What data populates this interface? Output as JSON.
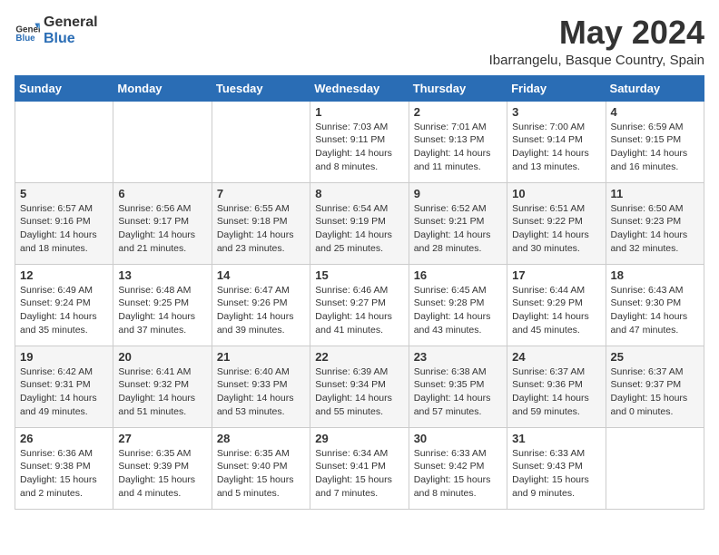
{
  "header": {
    "logo_general": "General",
    "logo_blue": "Blue",
    "month_title": "May 2024",
    "location": "Ibarrangelu, Basque Country, Spain"
  },
  "days_of_week": [
    "Sunday",
    "Monday",
    "Tuesday",
    "Wednesday",
    "Thursday",
    "Friday",
    "Saturday"
  ],
  "weeks": [
    [
      {
        "day": "",
        "content": ""
      },
      {
        "day": "",
        "content": ""
      },
      {
        "day": "",
        "content": ""
      },
      {
        "day": "1",
        "content": "Sunrise: 7:03 AM\nSunset: 9:11 PM\nDaylight: 14 hours\nand 8 minutes."
      },
      {
        "day": "2",
        "content": "Sunrise: 7:01 AM\nSunset: 9:13 PM\nDaylight: 14 hours\nand 11 minutes."
      },
      {
        "day": "3",
        "content": "Sunrise: 7:00 AM\nSunset: 9:14 PM\nDaylight: 14 hours\nand 13 minutes."
      },
      {
        "day": "4",
        "content": "Sunrise: 6:59 AM\nSunset: 9:15 PM\nDaylight: 14 hours\nand 16 minutes."
      }
    ],
    [
      {
        "day": "5",
        "content": "Sunrise: 6:57 AM\nSunset: 9:16 PM\nDaylight: 14 hours\nand 18 minutes."
      },
      {
        "day": "6",
        "content": "Sunrise: 6:56 AM\nSunset: 9:17 PM\nDaylight: 14 hours\nand 21 minutes."
      },
      {
        "day": "7",
        "content": "Sunrise: 6:55 AM\nSunset: 9:18 PM\nDaylight: 14 hours\nand 23 minutes."
      },
      {
        "day": "8",
        "content": "Sunrise: 6:54 AM\nSunset: 9:19 PM\nDaylight: 14 hours\nand 25 minutes."
      },
      {
        "day": "9",
        "content": "Sunrise: 6:52 AM\nSunset: 9:21 PM\nDaylight: 14 hours\nand 28 minutes."
      },
      {
        "day": "10",
        "content": "Sunrise: 6:51 AM\nSunset: 9:22 PM\nDaylight: 14 hours\nand 30 minutes."
      },
      {
        "day": "11",
        "content": "Sunrise: 6:50 AM\nSunset: 9:23 PM\nDaylight: 14 hours\nand 32 minutes."
      }
    ],
    [
      {
        "day": "12",
        "content": "Sunrise: 6:49 AM\nSunset: 9:24 PM\nDaylight: 14 hours\nand 35 minutes."
      },
      {
        "day": "13",
        "content": "Sunrise: 6:48 AM\nSunset: 9:25 PM\nDaylight: 14 hours\nand 37 minutes."
      },
      {
        "day": "14",
        "content": "Sunrise: 6:47 AM\nSunset: 9:26 PM\nDaylight: 14 hours\nand 39 minutes."
      },
      {
        "day": "15",
        "content": "Sunrise: 6:46 AM\nSunset: 9:27 PM\nDaylight: 14 hours\nand 41 minutes."
      },
      {
        "day": "16",
        "content": "Sunrise: 6:45 AM\nSunset: 9:28 PM\nDaylight: 14 hours\nand 43 minutes."
      },
      {
        "day": "17",
        "content": "Sunrise: 6:44 AM\nSunset: 9:29 PM\nDaylight: 14 hours\nand 45 minutes."
      },
      {
        "day": "18",
        "content": "Sunrise: 6:43 AM\nSunset: 9:30 PM\nDaylight: 14 hours\nand 47 minutes."
      }
    ],
    [
      {
        "day": "19",
        "content": "Sunrise: 6:42 AM\nSunset: 9:31 PM\nDaylight: 14 hours\nand 49 minutes."
      },
      {
        "day": "20",
        "content": "Sunrise: 6:41 AM\nSunset: 9:32 PM\nDaylight: 14 hours\nand 51 minutes."
      },
      {
        "day": "21",
        "content": "Sunrise: 6:40 AM\nSunset: 9:33 PM\nDaylight: 14 hours\nand 53 minutes."
      },
      {
        "day": "22",
        "content": "Sunrise: 6:39 AM\nSunset: 9:34 PM\nDaylight: 14 hours\nand 55 minutes."
      },
      {
        "day": "23",
        "content": "Sunrise: 6:38 AM\nSunset: 9:35 PM\nDaylight: 14 hours\nand 57 minutes."
      },
      {
        "day": "24",
        "content": "Sunrise: 6:37 AM\nSunset: 9:36 PM\nDaylight: 14 hours\nand 59 minutes."
      },
      {
        "day": "25",
        "content": "Sunrise: 6:37 AM\nSunset: 9:37 PM\nDaylight: 15 hours\nand 0 minutes."
      }
    ],
    [
      {
        "day": "26",
        "content": "Sunrise: 6:36 AM\nSunset: 9:38 PM\nDaylight: 15 hours\nand 2 minutes."
      },
      {
        "day": "27",
        "content": "Sunrise: 6:35 AM\nSunset: 9:39 PM\nDaylight: 15 hours\nand 4 minutes."
      },
      {
        "day": "28",
        "content": "Sunrise: 6:35 AM\nSunset: 9:40 PM\nDaylight: 15 hours\nand 5 minutes."
      },
      {
        "day": "29",
        "content": "Sunrise: 6:34 AM\nSunset: 9:41 PM\nDaylight: 15 hours\nand 7 minutes."
      },
      {
        "day": "30",
        "content": "Sunrise: 6:33 AM\nSunset: 9:42 PM\nDaylight: 15 hours\nand 8 minutes."
      },
      {
        "day": "31",
        "content": "Sunrise: 6:33 AM\nSunset: 9:43 PM\nDaylight: 15 hours\nand 9 minutes."
      },
      {
        "day": "",
        "content": ""
      }
    ]
  ]
}
